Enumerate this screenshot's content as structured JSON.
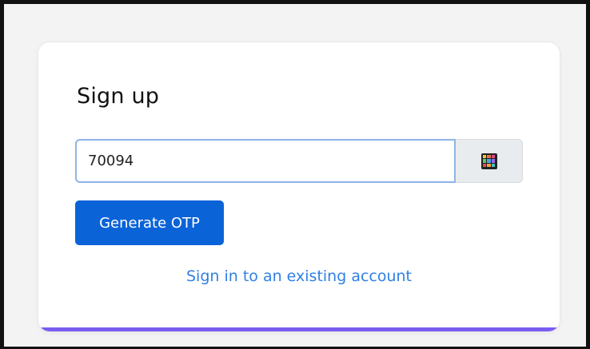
{
  "signup": {
    "title": "Sign up",
    "phone_value": "70094",
    "generate_label": "Generate OTP",
    "signin_link": "Sign in to an existing account"
  },
  "icons": {
    "keypad": "keypad-grid-icon"
  },
  "colors": {
    "primary_button": "#0b63d8",
    "link": "#2f80e4",
    "card_accent": "#7b5cf0",
    "input_focus_border": "#8fb4e6",
    "addon_background": "#e9ecef"
  }
}
